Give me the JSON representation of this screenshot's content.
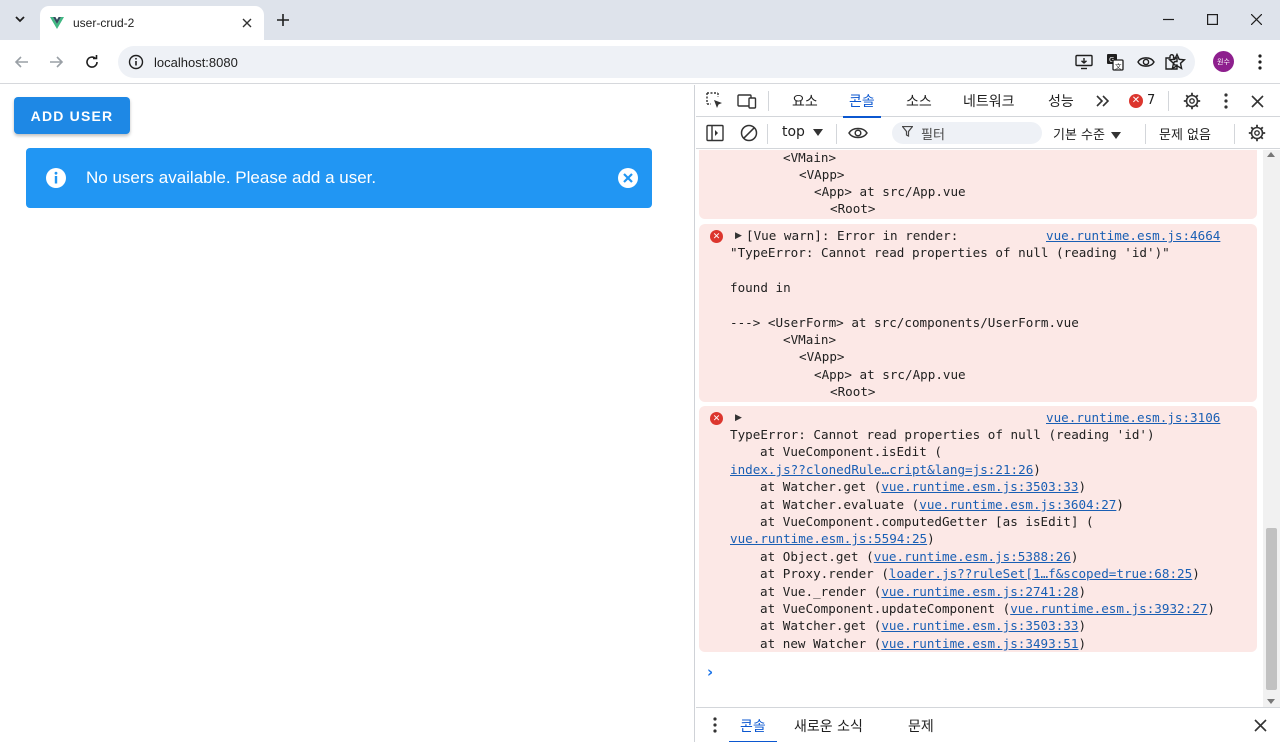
{
  "browser": {
    "tab_title": "user-crud-2",
    "url": "localhost:8080",
    "profile_initials": "원수"
  },
  "page": {
    "add_button_label": "ADD USER",
    "alert_text": "No users available. Please add a user."
  },
  "devtools": {
    "tabs": [
      "요소",
      "콘솔",
      "소스",
      "네트워크",
      "성능"
    ],
    "active_tab": "콘솔",
    "error_count": "7",
    "context": "top",
    "filter_placeholder": "필터",
    "level": "기본 수준",
    "issues": "문제 없음",
    "drawer_tabs": [
      "콘솔",
      "새로운 소식",
      "문제"
    ]
  },
  "console": {
    "msg0": {
      "lines": [
        "<VMain>",
        "<VApp>",
        "<App> at src/App.vue",
        "<Root>"
      ]
    },
    "msg1": {
      "head": "[Vue warn]: Error in render:",
      "source": "vue.runtime.esm.js:4664",
      "line1": "\"TypeError: Cannot read properties of null (reading 'id')\"",
      "line2": "found in",
      "line3": "---> <UserForm> at src/components/UserForm.vue",
      "line4": "<VMain>",
      "line5": "<VApp>",
      "line6": "<App> at src/App.vue",
      "line7": "<Root>"
    },
    "msg2": {
      "source": "vue.runtime.esm.js:3106",
      "error": "TypeError: Cannot read properties of null (reading 'id')",
      "s1a": "at VueComponent.isEdit (",
      "s1b": "index.js??clonedRule…cript&lang=js:21:26",
      "s1c": ")",
      "s2a": "at Watcher.get (",
      "s2b": "vue.runtime.esm.js:3503:33",
      "s2c": ")",
      "s3a": "at Watcher.evaluate (",
      "s3b": "vue.runtime.esm.js:3604:27",
      "s3c": ")",
      "s4a": "at VueComponent.computedGetter [as isEdit] (",
      "s4b": "vue.runtime.esm.js:5594:25",
      "s4c": ")",
      "s5a": "at Object.get (",
      "s5b": "vue.runtime.esm.js:5388:26",
      "s5c": ")",
      "s6a": "at Proxy.render (",
      "s6b": "loader.js??ruleSet[1…f&scoped=true:68:25",
      "s6c": ")",
      "s7a": "at Vue._render (",
      "s7b": "vue.runtime.esm.js:2741:28",
      "s7c": ")",
      "s8a": "at VueComponent.updateComponent (",
      "s8b": "vue.runtime.esm.js:3932:27",
      "s8c": ")",
      "s9a": "at Watcher.get (",
      "s9b": "vue.runtime.esm.js:3503:33",
      "s9c": ")",
      "s10a": "at new Watcher (",
      "s10b": "vue.runtime.esm.js:3493:51",
      "s10c": ")"
    }
  },
  "colors": {
    "primary": "#1e88e5",
    "alert": "#2196f3",
    "error": "#dc362e",
    "error_bg": "#fce8e6",
    "link": "#1a5fb4"
  }
}
